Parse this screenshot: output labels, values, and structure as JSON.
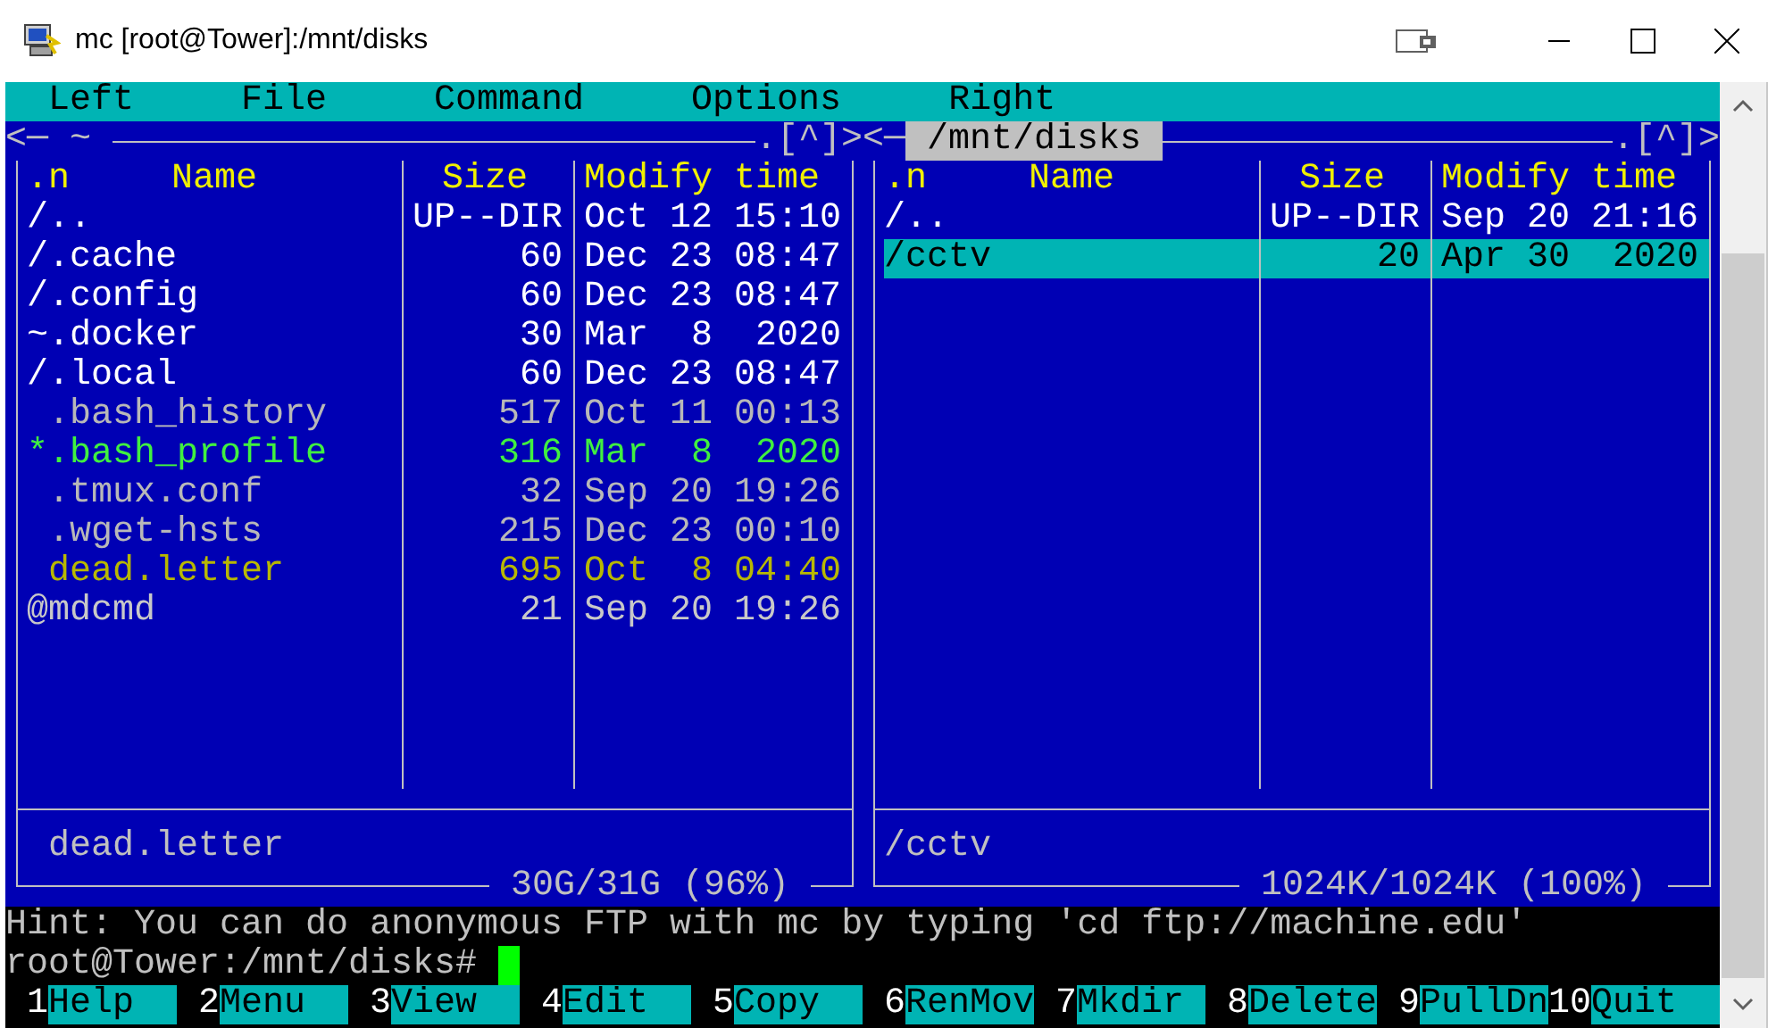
{
  "window": {
    "title": "mc [root@Tower]:/mnt/disks"
  },
  "menu": [
    "Left",
    "File",
    "Command",
    "Options",
    "Right"
  ],
  "panels": [
    {
      "active": false,
      "marker_left": "<─",
      "path": "~",
      "marker_right": ".[^]>",
      "columns": [
        ".n",
        "Name",
        "Size",
        "Modify time"
      ],
      "rows": [
        {
          "name": "/..",
          "size": "UP--DIR",
          "modified": "Oct 12 15:10",
          "kind": "directory",
          "selected": false
        },
        {
          "name": "/.cache",
          "size": "60",
          "modified": "Dec 23 08:47",
          "kind": "directory",
          "selected": false
        },
        {
          "name": "/.config",
          "size": "60",
          "modified": "Dec 23 08:47",
          "kind": "directory",
          "selected": false
        },
        {
          "name": "~.docker",
          "size": "30",
          "modified": "Mar  8  2020",
          "kind": "directory",
          "selected": false
        },
        {
          "name": "/.local",
          "size": "60",
          "modified": "Dec 23 08:47",
          "kind": "directory",
          "selected": false
        },
        {
          "name": " .bash_history",
          "size": "517",
          "modified": "Oct 11 00:13",
          "kind": "file",
          "selected": false
        },
        {
          "name": "*.bash_profile",
          "size": "316",
          "modified": "Mar  8  2020",
          "kind": "executable",
          "selected": false
        },
        {
          "name": " .tmux.conf",
          "size": "32",
          "modified": "Sep 20 19:26",
          "kind": "file",
          "selected": false
        },
        {
          "name": " .wget-hsts",
          "size": "215",
          "modified": "Dec 23 00:10",
          "kind": "file",
          "selected": false
        },
        {
          "name": " dead.letter",
          "size": "695",
          "modified": "Oct  8 04:40",
          "kind": "core",
          "selected": false
        },
        {
          "name": "@mdcmd",
          "size": "21",
          "modified": "Sep 20 19:26",
          "kind": "symlink",
          "selected": false
        }
      ],
      "mini_status": " dead.letter",
      "free_space": "30G/31G (96%)"
    },
    {
      "active": true,
      "marker_left": "<─",
      "path": "/mnt/disks",
      "marker_right": ".[^]>",
      "columns": [
        ".n",
        "Name",
        "Size",
        "Modify time"
      ],
      "rows": [
        {
          "name": "/..",
          "size": "UP--DIR",
          "modified": "Sep 20 21:16",
          "kind": "directory",
          "selected": false
        },
        {
          "name": "/cctv",
          "size": "20",
          "modified": "Apr 30  2020",
          "kind": "directory",
          "selected": true
        }
      ],
      "mini_status": "/cctv",
      "free_space": "1024K/1024K (100%)"
    }
  ],
  "hint": "Hint: You can do anonymous FTP with mc by typing 'cd ftp://machine.edu'",
  "prompt": "root@Tower:/mnt/disks#",
  "function_keys": [
    {
      "number": "1",
      "label": "Help"
    },
    {
      "number": "2",
      "label": "Menu"
    },
    {
      "number": "3",
      "label": "View"
    },
    {
      "number": "4",
      "label": "Edit"
    },
    {
      "number": "5",
      "label": "Copy"
    },
    {
      "number": "6",
      "label": "RenMov"
    },
    {
      "number": "7",
      "label": "Mkdir"
    },
    {
      "number": "8",
      "label": "Delete"
    },
    {
      "number": "9",
      "label": "PullDn"
    },
    {
      "number": "10",
      "label": "Quit"
    }
  ]
}
